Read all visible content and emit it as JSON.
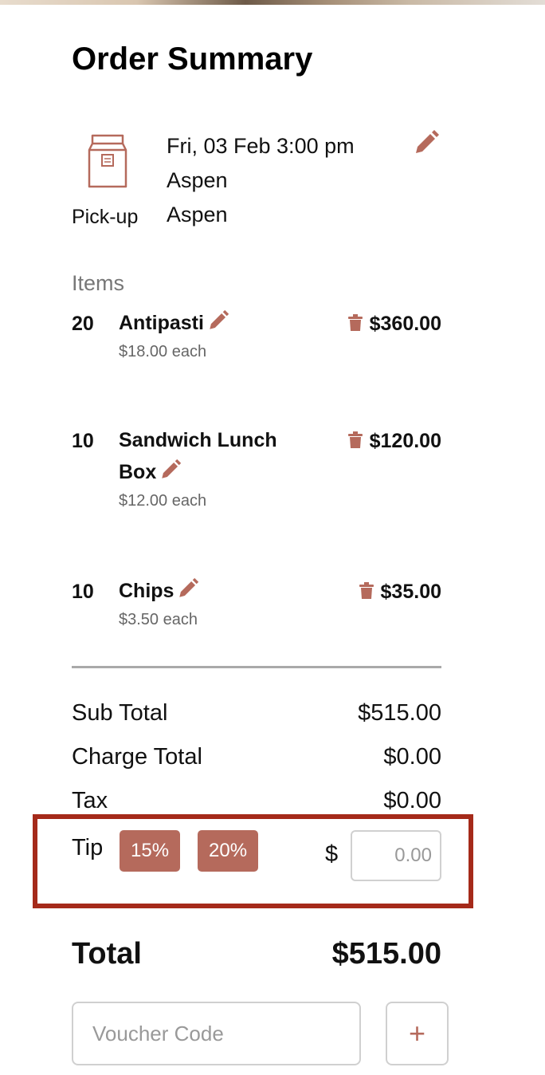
{
  "colors": {
    "accent": "#b56a5c",
    "highlight_border": "#a52a1a",
    "muted_text": "#777777",
    "divider": "#a9a9a9"
  },
  "title": "Order Summary",
  "pickup": {
    "icon": "shopping-bag-icon",
    "label": "Pick-up",
    "datetime": "Fri, 03 Feb 3:00 pm",
    "location_line1": "Aspen",
    "location_line2": "Aspen",
    "edit_icon": "pencil-icon"
  },
  "items_heading": "Items",
  "items": [
    {
      "qty": "20",
      "name": "Antipasti",
      "each": "$18.00 each",
      "price": "$360.00"
    },
    {
      "qty": "10",
      "name": "Sandwich Lunch Box",
      "each": "$12.00 each",
      "price": "$120.00"
    },
    {
      "qty": "10",
      "name": "Chips",
      "each": "$3.50 each",
      "price": "$35.00"
    }
  ],
  "totals": {
    "sub_total_label": "Sub Total",
    "sub_total_value": "$515.00",
    "charge_total_label": "Charge Total",
    "charge_total_value": "$0.00",
    "tax_label": "Tax",
    "tax_value": "$0.00"
  },
  "tip": {
    "label": "Tip",
    "option_1": "15%",
    "option_2": "20%",
    "currency": "$",
    "placeholder": "0.00"
  },
  "grand_total": {
    "label": "Total",
    "value": "$515.00"
  },
  "voucher": {
    "placeholder": "Voucher Code",
    "add_label": "+"
  }
}
